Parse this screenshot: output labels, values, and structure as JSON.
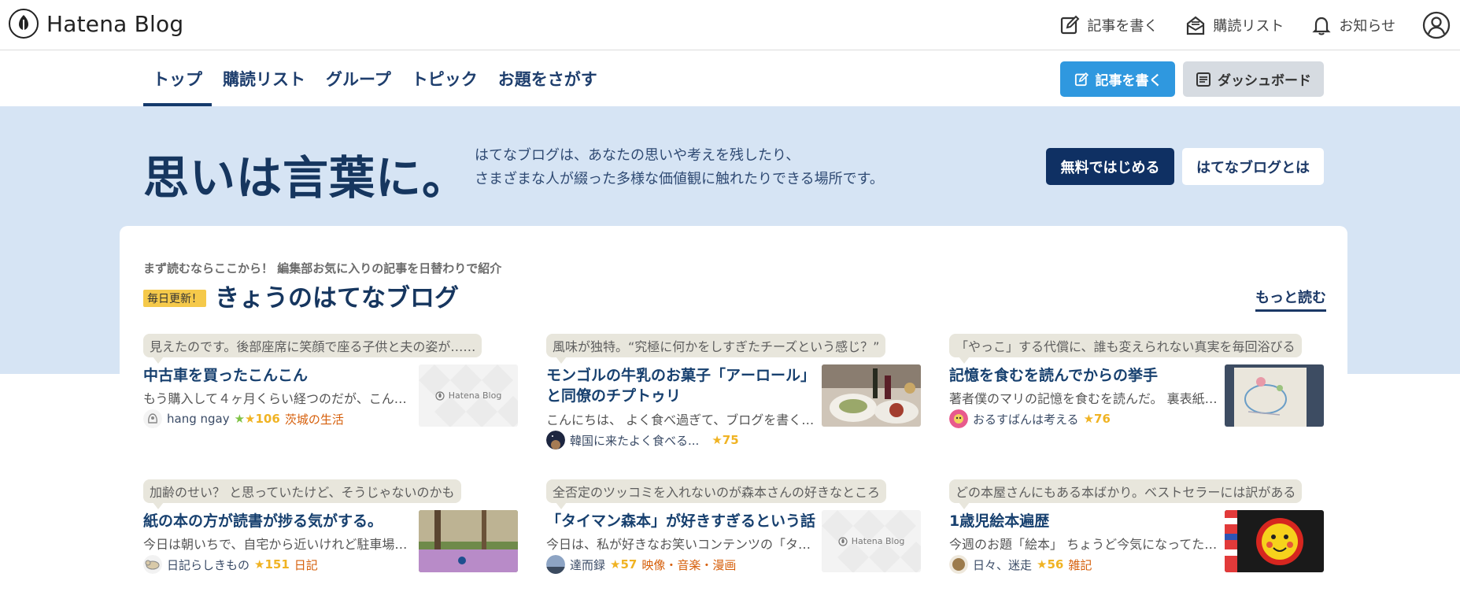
{
  "header": {
    "logo_text": "Hatena Blog",
    "actions": [
      {
        "label": "記事を書く",
        "icon": "edit-icon"
      },
      {
        "label": "購読リスト",
        "icon": "inbox-icon"
      },
      {
        "label": "お知らせ",
        "icon": "bell-icon"
      }
    ],
    "user_icon": "user-icon"
  },
  "nav": {
    "tabs": [
      "トップ",
      "購読リスト",
      "グループ",
      "トピック",
      "お題をさがす"
    ],
    "active_tab": "トップ",
    "write_button": "記事を書く",
    "dashboard_button": "ダッシュボード"
  },
  "hero": {
    "title": "思いは言葉に。",
    "desc_line1": "はてなブログは、あなたの思いや考えを残したり、",
    "desc_line2": "さまざまな人が綴った多様な価値観に触れたりできる場所です。",
    "start_button": "無料ではじめる",
    "about_button": "はてなブログとは"
  },
  "today": {
    "subtitle": "まず読むならここから！ 編集部お気に入りの記事を日替わりで紹介",
    "badge": "毎日更新！",
    "title": "きょうのはてなブログ",
    "more_link": "もっと読む",
    "entries": [
      {
        "quote": "見えたのです。後部座席に笑顔で座る子供と夫の姿が……",
        "title": "中古車を買ったこんこん",
        "excerpt": "もう購入して４ヶ月くらい経つのだが、こん…",
        "author": "hang ngay",
        "stars": "106",
        "category": "茨城の生活",
        "thumb": "placeholder"
      },
      {
        "quote": "風味が独特。“究極に何かをしすぎたチーズという感じ？”",
        "title": "モンゴルの牛乳のお菓子「アーロール」と同僚のチプトゥリ",
        "excerpt": "こんにちは、 よく食べ過ぎて、ブログを書く…",
        "author": "韓国に来たよく食べる...",
        "stars": "75",
        "category": "",
        "thumb": "food"
      },
      {
        "quote": "「やっこ」する代償に、誰も変えられない真実を毎回浴びる",
        "title": "記憶を食むを読んでからの挙手",
        "excerpt": "著者僕のマリの記憶を食むを読んだ。 裏表紙…",
        "author": "おるすばんは考える",
        "stars": "76",
        "category": "",
        "thumb": "paper"
      },
      {
        "quote": "加齢のせい？ と思っていたけど、そうじゃないのかも",
        "title": "紙の本の方が読書が捗る気がする。",
        "excerpt": "今日は朝いちで、自宅から近いけれど駐車場…",
        "author": "日記らしきもの",
        "stars": "151",
        "category": "日記",
        "thumb": "park"
      },
      {
        "quote": "全否定のツッコミを入れないのが森本さんの好きなところ",
        "title": "「タイマン森本」が好きすぎるという話",
        "excerpt": "今日は、私が好きなお笑いコンテンツの「タ…",
        "author": "達而録",
        "stars": "57",
        "category": "映像・音楽・漫画",
        "thumb": "placeholder"
      },
      {
        "quote": "どの本屋さんにもある本ばかり。ベストセラーには訳がある",
        "title": "1歳児絵本遍歴",
        "excerpt": "今週のお題「絵本」 ちょうど今気になってた…",
        "author": "日々、迷走",
        "stars": "56",
        "category": "雑記",
        "thumb": "sun"
      }
    ]
  },
  "placeholder_logo": "Hatena Blog",
  "colors": {
    "navy": "#16365f",
    "accent_blue": "#2f98df",
    "hero_bg": "#d6e4f4",
    "star": "#f0b323",
    "category": "#d65f0b"
  }
}
